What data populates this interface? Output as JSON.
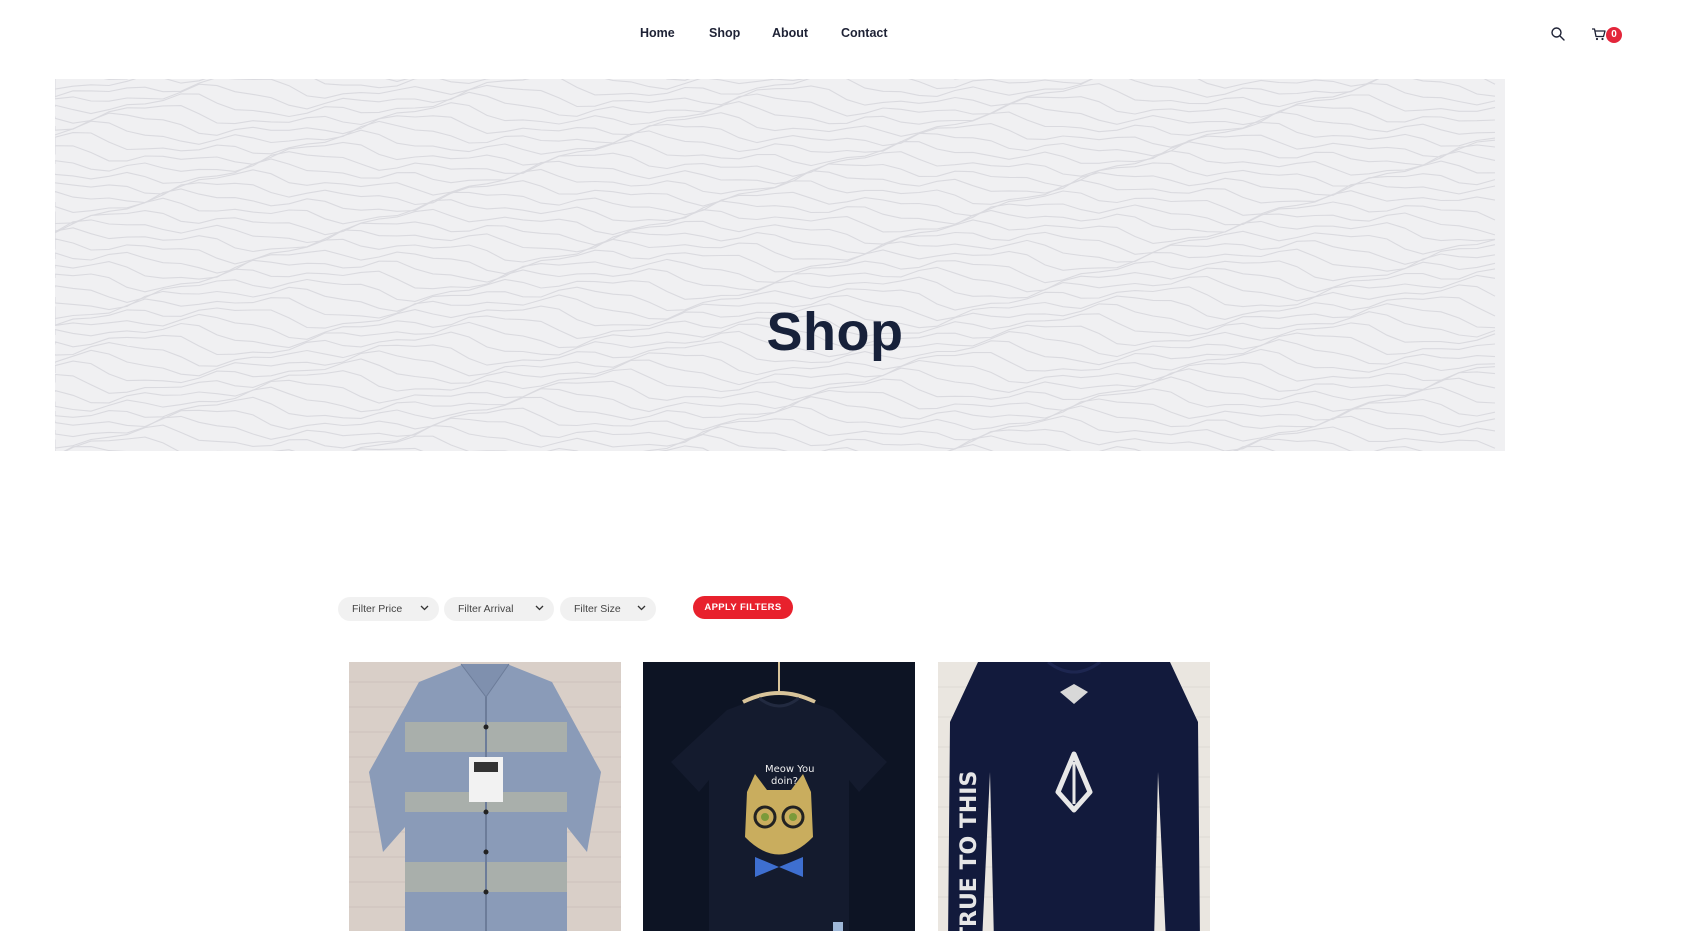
{
  "nav": {
    "items": [
      {
        "label": "Home"
      },
      {
        "label": "Shop"
      },
      {
        "label": "About"
      },
      {
        "label": "Contact"
      }
    ]
  },
  "header": {
    "cart_count": "0",
    "icons": [
      "search-icon",
      "cart-icon"
    ]
  },
  "hero": {
    "title": "Shop"
  },
  "filters": {
    "price": "Filter Price",
    "arrival": "Filter Arrival",
    "size": "Filter Size",
    "apply": "APPLY FILTERS"
  },
  "products": [
    {
      "image": "blue-patterned-button-shirt"
    },
    {
      "image": "navy-cat-graphic-tshirt"
    },
    {
      "image": "navy-long-sleeve-logo-shirt"
    }
  ],
  "colors": {
    "accent": "#e8212d",
    "badge": "#e3263b",
    "text": "#1e2235",
    "hero_bg": "#f0f0f2"
  }
}
